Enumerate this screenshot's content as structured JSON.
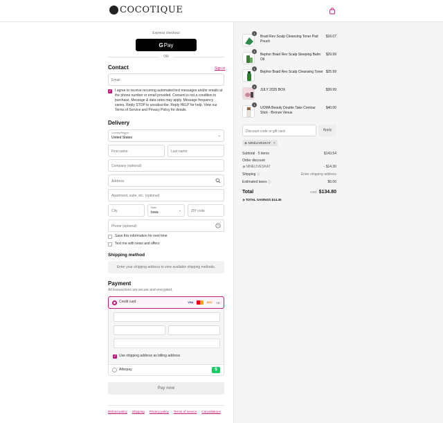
{
  "header": {
    "brand": "COCOTIQUE",
    "cart_icon": "shopping-bag-icon"
  },
  "express": {
    "label": "Express checkout",
    "gpay_label": "Pay",
    "or_label": "OR"
  },
  "contact": {
    "title": "Contact",
    "signin": "Sign in",
    "email_placeholder": "Email",
    "sms_consent": "I agree to receive recurring automated text messages and/or emails at the phone number or email provided. Consent is not a condition to purchase. Message & data rates may apply. Message frequency varies. Reply STOP to unsubscribe. Reply HELP for help. View our Terms of Service and Privacy Policy for details.",
    "sms_checked": true
  },
  "delivery": {
    "title": "Delivery",
    "country_label": "Country/Region",
    "country_value": "United States",
    "first_name": "First name",
    "last_name": "Last name",
    "company": "Company (optional)",
    "address": "Address",
    "apartment": "Apartment, suite, etc. (optional)",
    "city": "City",
    "state_label": "State",
    "state_value": "Iowa",
    "zip": "ZIP code",
    "phone": "Phone (optional)",
    "save_info": "Save this information for next time",
    "text_offers": "Text me with news and offers"
  },
  "shipping": {
    "title": "Shipping method",
    "note": "Enter your shipping address to view available shipping methods."
  },
  "payment": {
    "title": "Payment",
    "subtitle": "All transactions are secure and encrypted.",
    "credit_card": "Credit card",
    "card_brands": [
      "VISA",
      "MC",
      "DISC"
    ],
    "more_brands": "+3",
    "billing_same": "Use shipping address as billing address",
    "afterpay": "Afterpay",
    "pay_now": "Pay now"
  },
  "footer": {
    "links": [
      "Refund policy",
      "Shipping",
      "Privacy policy",
      "Terms of service",
      "Cancellations"
    ]
  },
  "cart": {
    "items": [
      {
        "name": "Braid Rev Scalp Cleansing Toner Pad Pouch",
        "price": "$16.07",
        "qty": "1",
        "thumb_color": "#2f8a4a"
      },
      {
        "name": "Bephor Braid Rev Scalp Sleeping Balm Oil",
        "price": "$29.99",
        "qty": "1",
        "thumb_color": "#3f7a3a"
      },
      {
        "name": "Bephor Braid Rev Scalp Cleansing Toner",
        "price": "$25.99",
        "qty": "1",
        "thumb_color": "#2e7d32"
      },
      {
        "name": "JULY 2025 BOX",
        "price": "$39.99",
        "qty": "1",
        "thumb_color": "#c98a9a"
      },
      {
        "name": "UOMA Beauty Double Take Contour Stick - Bronze Venus",
        "price": "$40.00",
        "qty": "1",
        "thumb_color": "#8a6a4a"
      }
    ],
    "discount_placeholder": "Discount code or gift card",
    "apply": "Apply",
    "applied_code": "NINELIVESKAT",
    "subtotal_label": "Subtotal · 5 items",
    "subtotal_value": "$143.54",
    "order_discount_label": "Order discount",
    "discount_code": "NINELIVESKAT",
    "discount_value": "- $14.30",
    "shipping_label": "Shipping",
    "shipping_value": "Enter shipping address",
    "taxes_label": "Estimated taxes",
    "taxes_value": "$6.06",
    "total_label": "Total",
    "currency": "USD",
    "total_value": "$134.80",
    "savings_label": "TOTAL SAVINGS",
    "savings_value": "$14.30"
  },
  "colors": {
    "accent": "#c2187c",
    "sidebar_bg": "#f5f5f5"
  }
}
